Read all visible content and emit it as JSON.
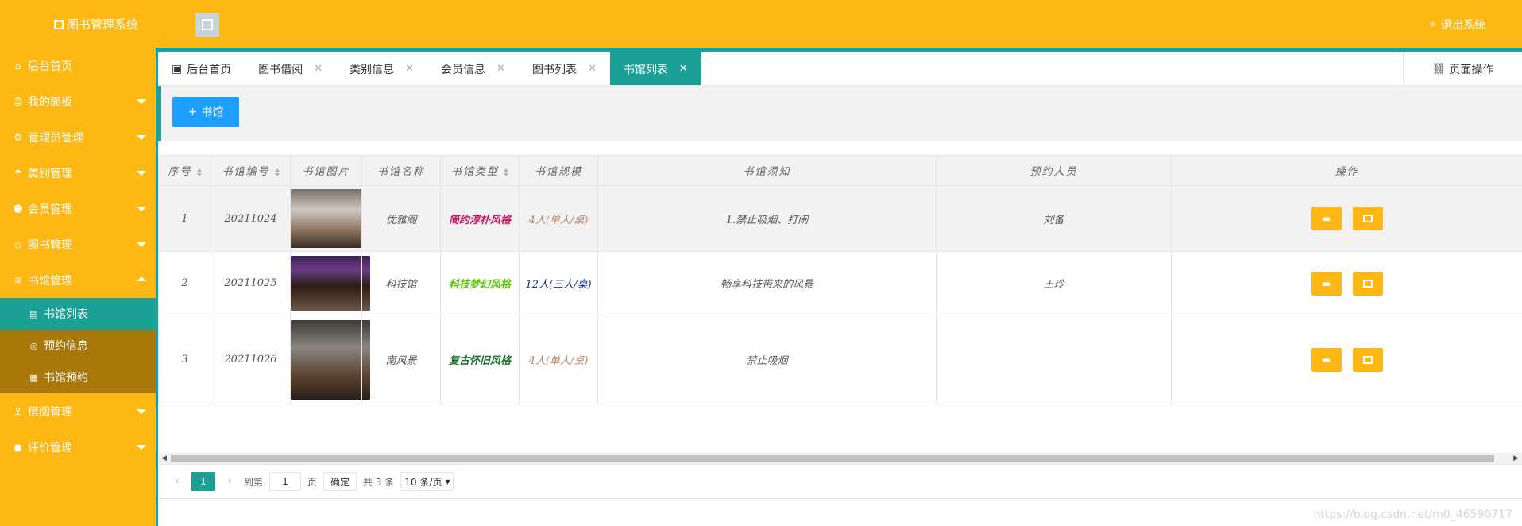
{
  "header": {
    "title": "图书管理系统",
    "logout": "退出系统"
  },
  "sidebar": {
    "items": [
      {
        "label": "后台首页",
        "icon": "home-icon"
      },
      {
        "label": "我的面板",
        "icon": "user-icon"
      },
      {
        "label": "管理员管理",
        "icon": "gear-icon"
      },
      {
        "label": "类别管理",
        "icon": "umbrella-icon"
      },
      {
        "label": "会员管理",
        "icon": "users-icon"
      },
      {
        "label": "图书管理",
        "icon": "tag-icon"
      },
      {
        "label": "书馆管理",
        "icon": "layers-icon"
      }
    ],
    "sub_items": [
      {
        "label": "书馆列表",
        "icon": "library-icon"
      },
      {
        "label": "预约信息",
        "icon": "chat-icon"
      },
      {
        "label": "书馆预约",
        "icon": "calendar-icon"
      }
    ],
    "bottom_items": [
      {
        "label": "借阅管理",
        "icon": "cart-icon"
      },
      {
        "label": "评价管理",
        "icon": "comment-icon"
      }
    ]
  },
  "tabs": [
    {
      "label": "后台首页"
    },
    {
      "label": "图书借阅"
    },
    {
      "label": "类别信息"
    },
    {
      "label": "会员信息"
    },
    {
      "label": "图书列表"
    },
    {
      "label": "书馆列表"
    }
  ],
  "page_ops": "页面操作",
  "toolbar": {
    "add_label": "书馆"
  },
  "table": {
    "headers": [
      "序号",
      "书馆编号",
      "书馆图片",
      "书馆名称",
      "书馆类型",
      "书馆规模",
      "书馆须知",
      "预约人员",
      "操作"
    ],
    "rows": [
      {
        "no": "1",
        "code": "20211024",
        "name": "优雅阁",
        "type": "简约淳朴风格",
        "scale": "4人(单人/桌)",
        "notice": "1.禁止吸烟、打闹",
        "person": "刘备"
      },
      {
        "no": "2",
        "code": "20211025",
        "name": "科技馆",
        "type": "科技梦幻风格",
        "scale": "12人(三人/桌)",
        "notice": "畅享科技带来的风景",
        "person": "王玲"
      },
      {
        "no": "3",
        "code": "20211026",
        "name": "南风景",
        "type": "复古怀旧风格",
        "scale": "4人(单人/桌)",
        "notice": "禁止吸烟",
        "person": ""
      }
    ]
  },
  "pager": {
    "current": "1",
    "goto_label": "到第",
    "goto_value": "1",
    "page_label": "页",
    "confirm": "确定",
    "total": "共 3 条",
    "per_page": "10 条/页"
  },
  "watermark": "https://blog.csdn.net/m0_46590717",
  "colors": {
    "primary": "#fdb813",
    "accent": "#1aa094",
    "button": "#1e9fff"
  }
}
